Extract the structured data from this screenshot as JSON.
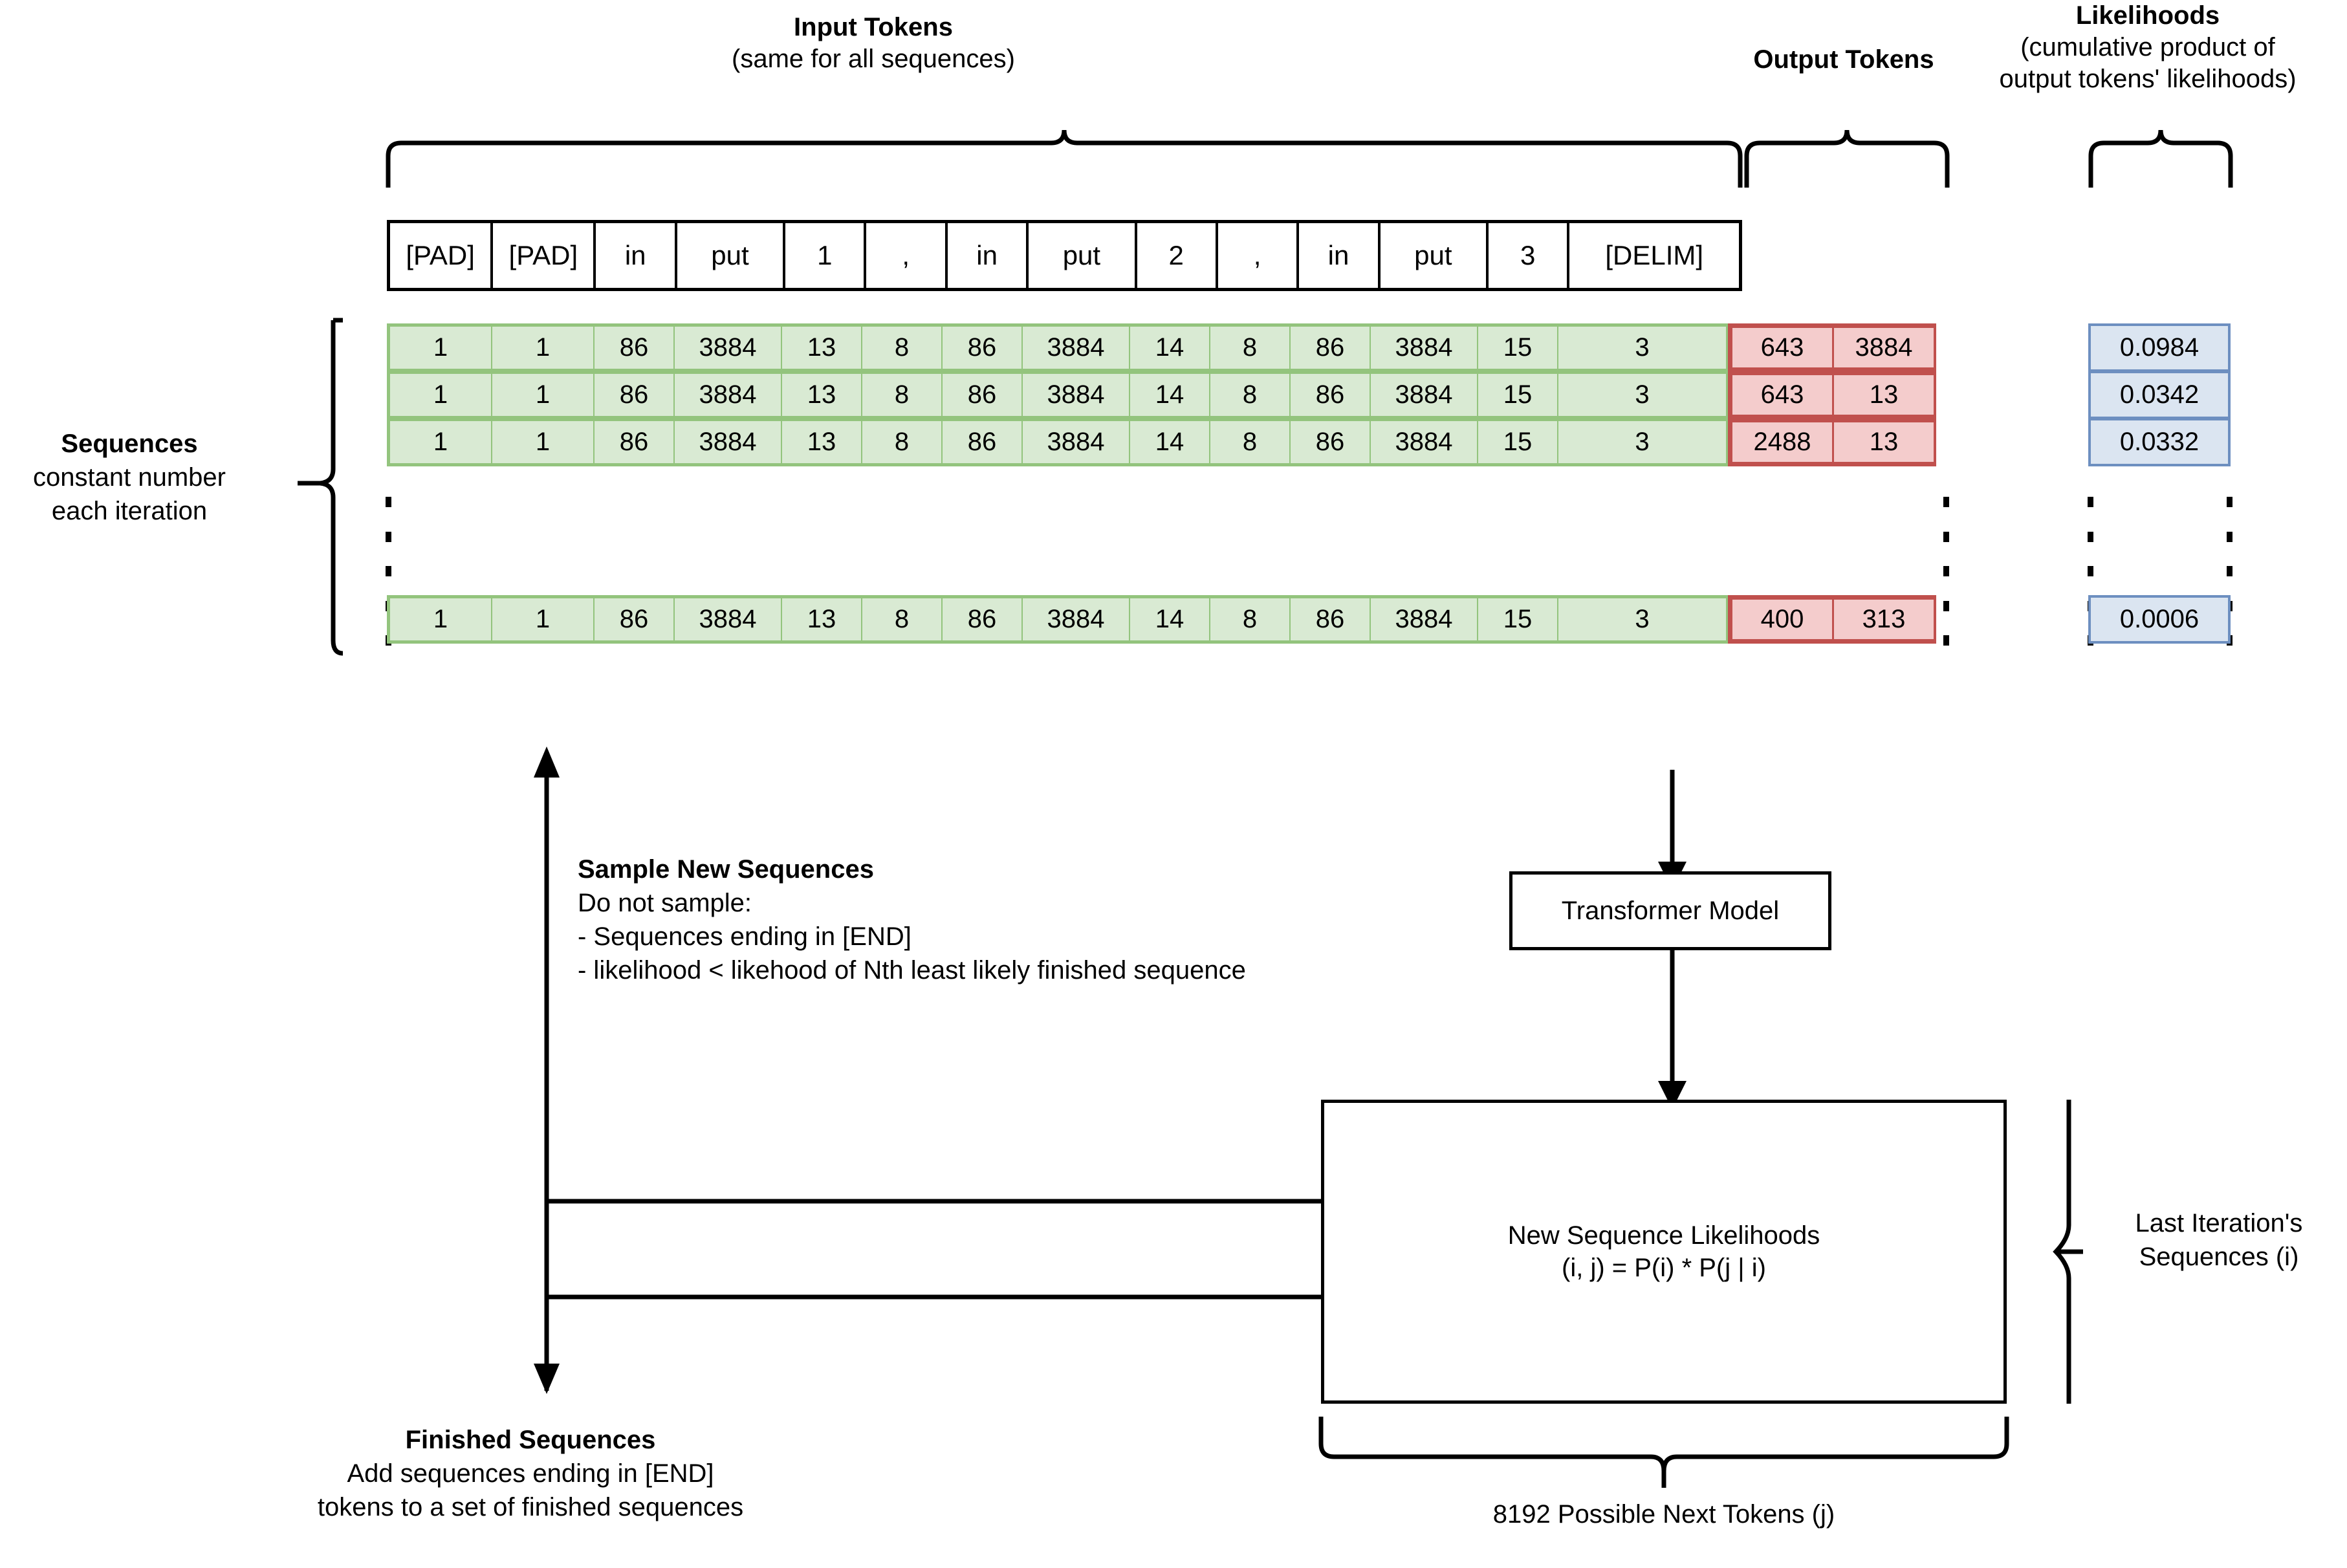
{
  "headers": {
    "input_tokens_title": "Input Tokens",
    "input_tokens_sub": "(same for all sequences)",
    "output_tokens_title": "Output Tokens",
    "likelihoods_title": "Likelihoods",
    "likelihoods_sub_1": "(cumulative product of",
    "likelihoods_sub_2": "output tokens' likelihoods)"
  },
  "sequences_label": {
    "title": "Sequences",
    "line1": "constant number",
    "line2": "each iteration"
  },
  "token_strip": [
    "[PAD]",
    "[PAD]",
    "in",
    "put",
    "1",
    ",",
    "in",
    "put",
    "2",
    ",",
    "in",
    "put",
    "3",
    "[DELIM]"
  ],
  "sequence_rows": [
    {
      "input": [
        "1",
        "1",
        "86",
        "3884",
        "13",
        "8",
        "86",
        "3884",
        "14",
        "8",
        "86",
        "3884",
        "15",
        "3"
      ],
      "output": [
        "643",
        "3884"
      ],
      "likelihood": "0.0984"
    },
    {
      "input": [
        "1",
        "1",
        "86",
        "3884",
        "13",
        "8",
        "86",
        "3884",
        "14",
        "8",
        "86",
        "3884",
        "15",
        "3"
      ],
      "output": [
        "643",
        "13"
      ],
      "likelihood": "0.0342"
    },
    {
      "input": [
        "1",
        "1",
        "86",
        "3884",
        "13",
        "8",
        "86",
        "3884",
        "14",
        "8",
        "86",
        "3884",
        "15",
        "3"
      ],
      "output": [
        "2488",
        "13"
      ],
      "likelihood": "0.0332"
    }
  ],
  "last_row": {
    "input": [
      "1",
      "1",
      "86",
      "3884",
      "13",
      "8",
      "86",
      "3884",
      "14",
      "8",
      "86",
      "3884",
      "15",
      "3"
    ],
    "output": [
      "400",
      "313"
    ],
    "likelihood": "0.0006"
  },
  "sample_block": {
    "title": "Sample New Sequences",
    "line1": "Do not sample:",
    "line2": "- Sequences ending in [END]",
    "line3": "- likelihood < likehood of Nth least likely finished sequence"
  },
  "transformer_box": {
    "label": "Transformer Model"
  },
  "likelihood_box": {
    "line1": "New Sequence Likelihoods",
    "line2": "(i, j) = P(i) * P(j | i)"
  },
  "right_brace_label": {
    "line1": "Last Iteration's",
    "line2": "Sequences (i)"
  },
  "bottom_brace_label": "8192 Possible Next Tokens (j)",
  "finished_block": {
    "title": "Finished Sequences",
    "line1": "Add sequences ending in [END]",
    "line2": "tokens to a set of finished sequences"
  },
  "colors": {
    "green_fill": "#d9ead3",
    "green_border": "#93c47d",
    "red_fill": "#f4cccc",
    "red_border": "#c0504d",
    "blue_fill": "#dbe5f1",
    "blue_border": "#6d8fc0",
    "stroke": "#000000"
  }
}
